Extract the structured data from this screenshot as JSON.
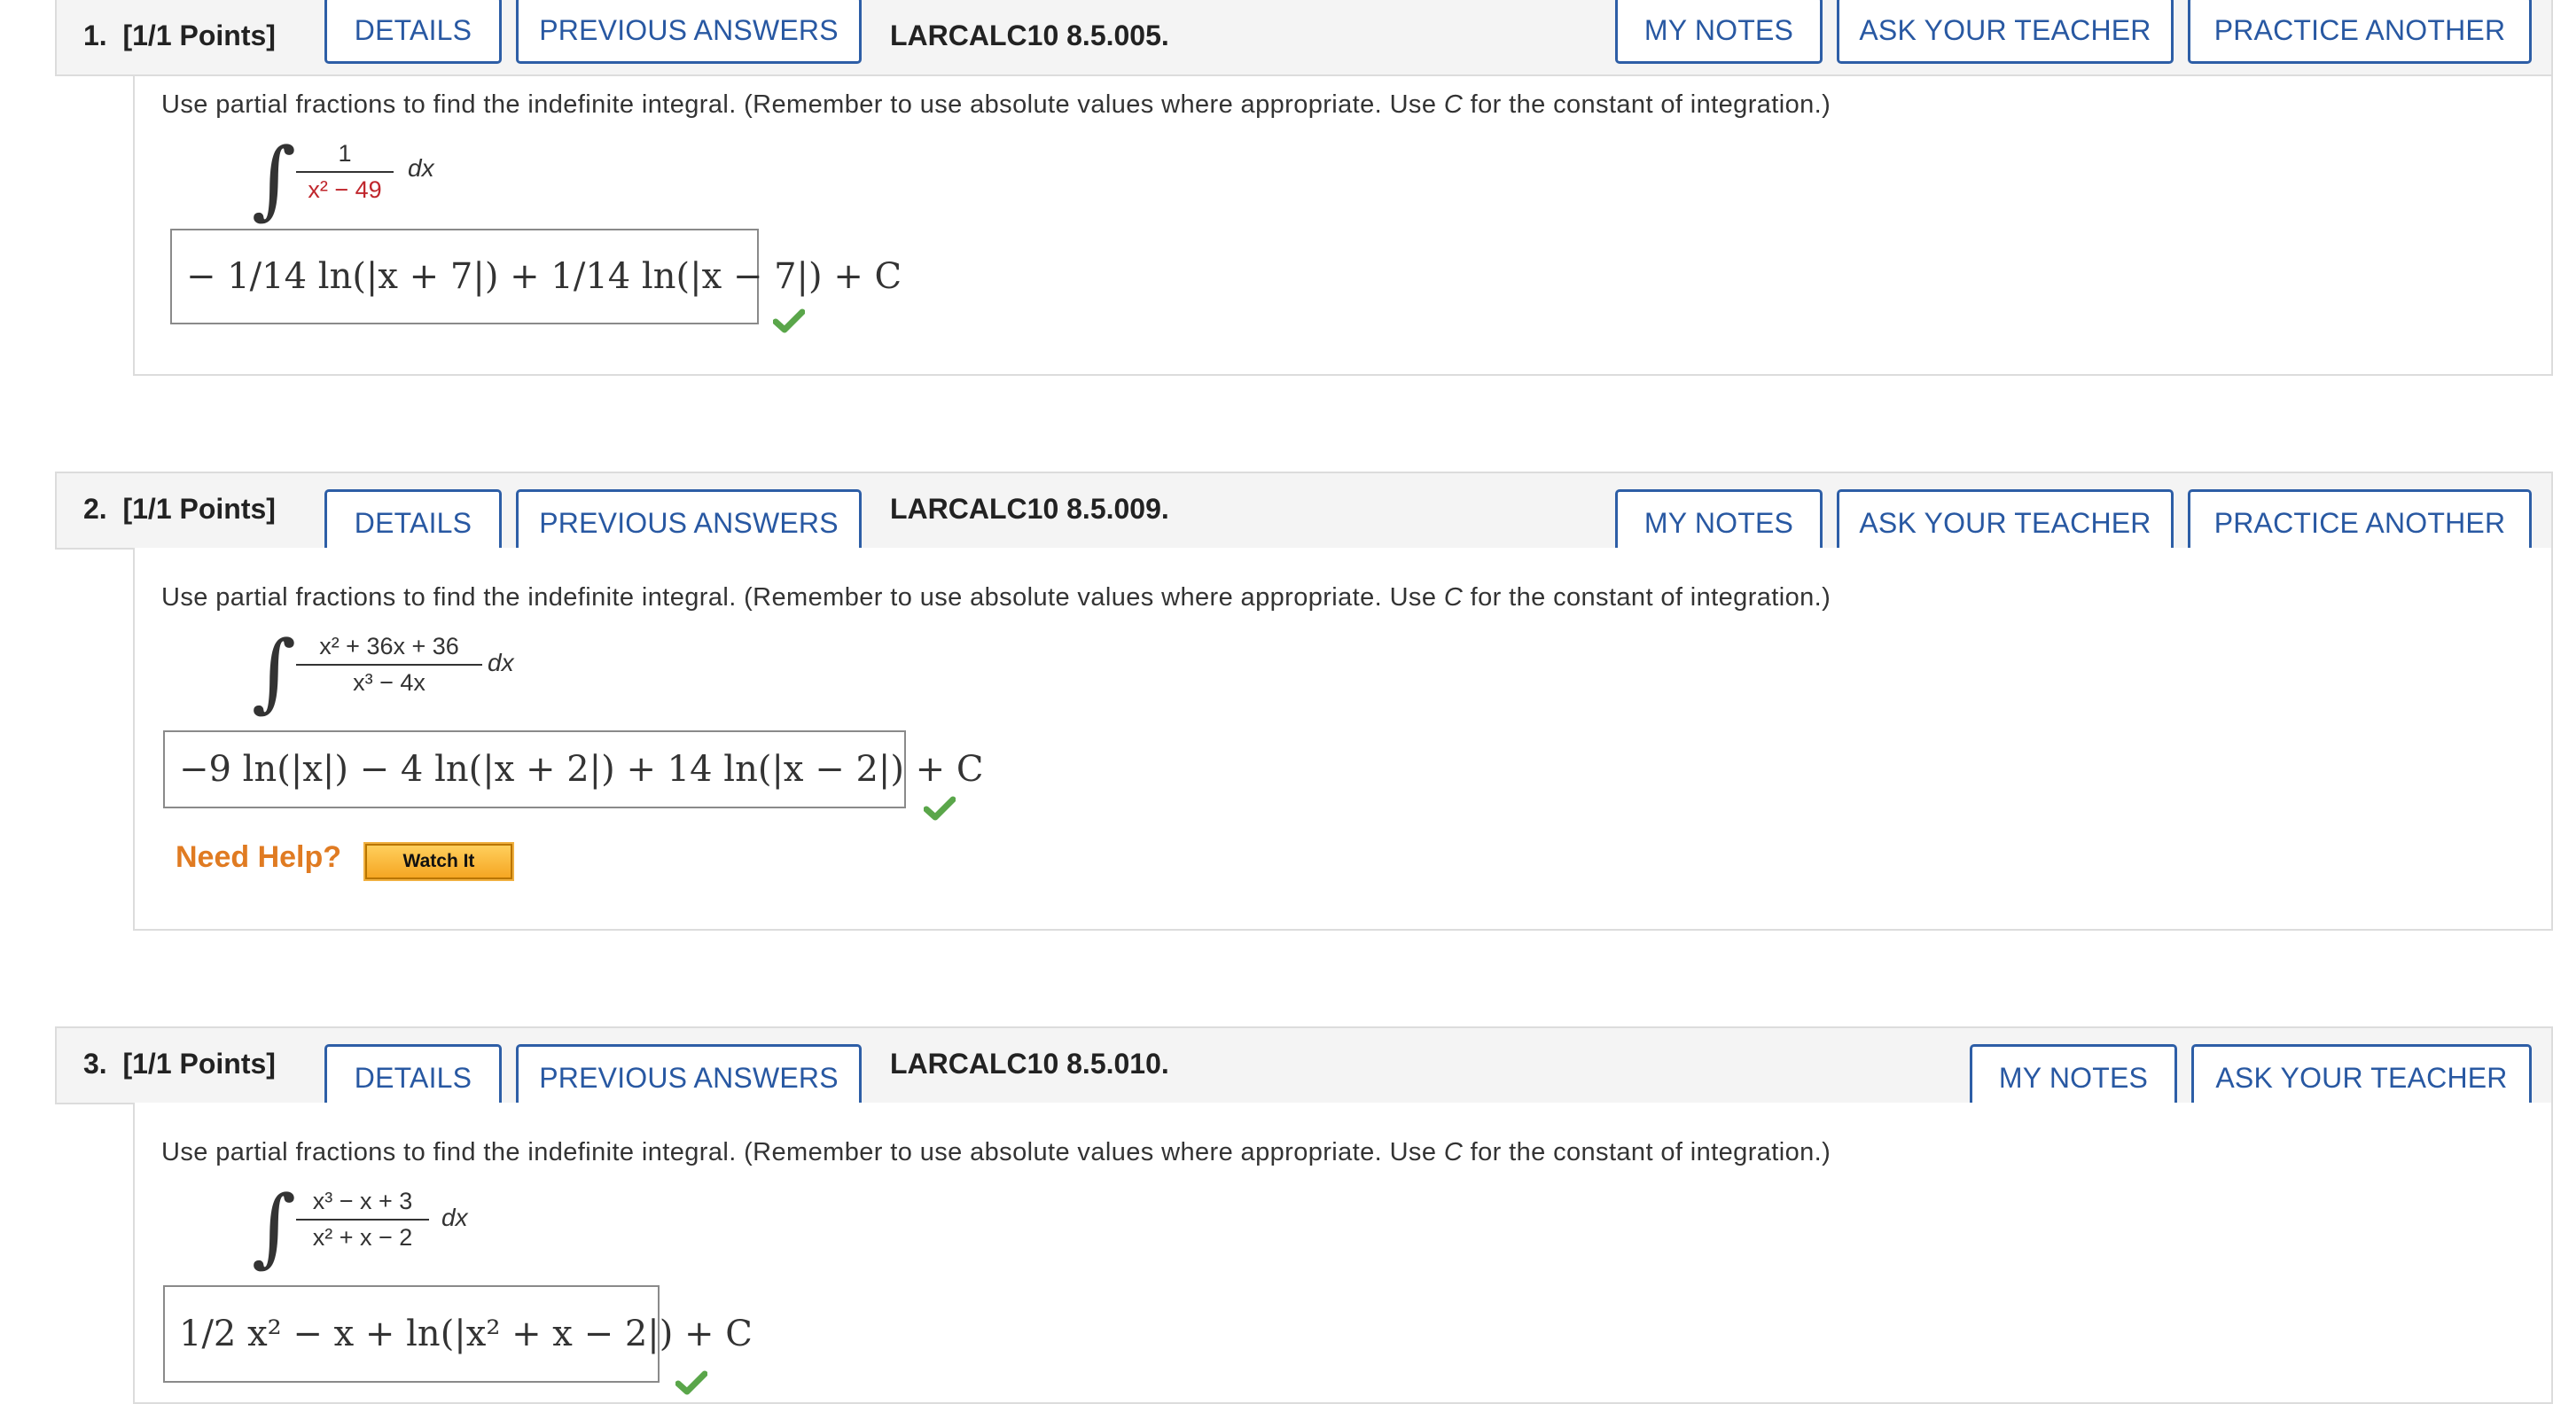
{
  "header_buttons": {
    "details": "DETAILS",
    "previous_answers": "PREVIOUS ANSWERS",
    "my_notes": "MY NOTES",
    "ask_teacher": "ASK YOUR TEACHER",
    "practice_another": "PRACTICE ANOTHER"
  },
  "prompt_text": {
    "part1": "Use partial fractions to find the indefinite integral. (Remember to use absolute values where appropriate. Use ",
    "var": "C",
    "part2": " for the constant of integration.)"
  },
  "questions": [
    {
      "number": "1.",
      "points": "[1/1 Points]",
      "code": "LARCALC10 8.5.005.",
      "numerator": "1",
      "denominator": "x² − 49",
      "dx": "dx",
      "answer": "− 1/14 ln(|x + 7|) + 1/14 ln(|x − 7|) + C",
      "status": "correct"
    },
    {
      "number": "2.",
      "points": "[1/1 Points]",
      "code": "LARCALC10 8.5.009.",
      "numerator": "x² + 36x + 36",
      "denominator": "x³ − 4x",
      "dx": "dx",
      "answer": "−9 ln(|x|) − 4 ln(|x + 2|) + 14 ln(|x − 2|) + C",
      "status": "correct",
      "need_help": "Need Help?",
      "watch_it": "Watch It"
    },
    {
      "number": "3.",
      "points": "[1/1 Points]",
      "code": "LARCALC10 8.5.010.",
      "numerator": "x³ − x + 3",
      "denominator": "x² + x − 2",
      "dx": "dx",
      "answer": "1/2 x² − x + ln(|x² + x − 2|) + C",
      "status": "correct"
    }
  ],
  "colors": {
    "button_blue": "#2858a2",
    "help_orange": "#e07b22",
    "check_green": "#5aa64a",
    "red_value": "#c0272d"
  },
  "icons": [
    "checkmark-icon"
  ]
}
